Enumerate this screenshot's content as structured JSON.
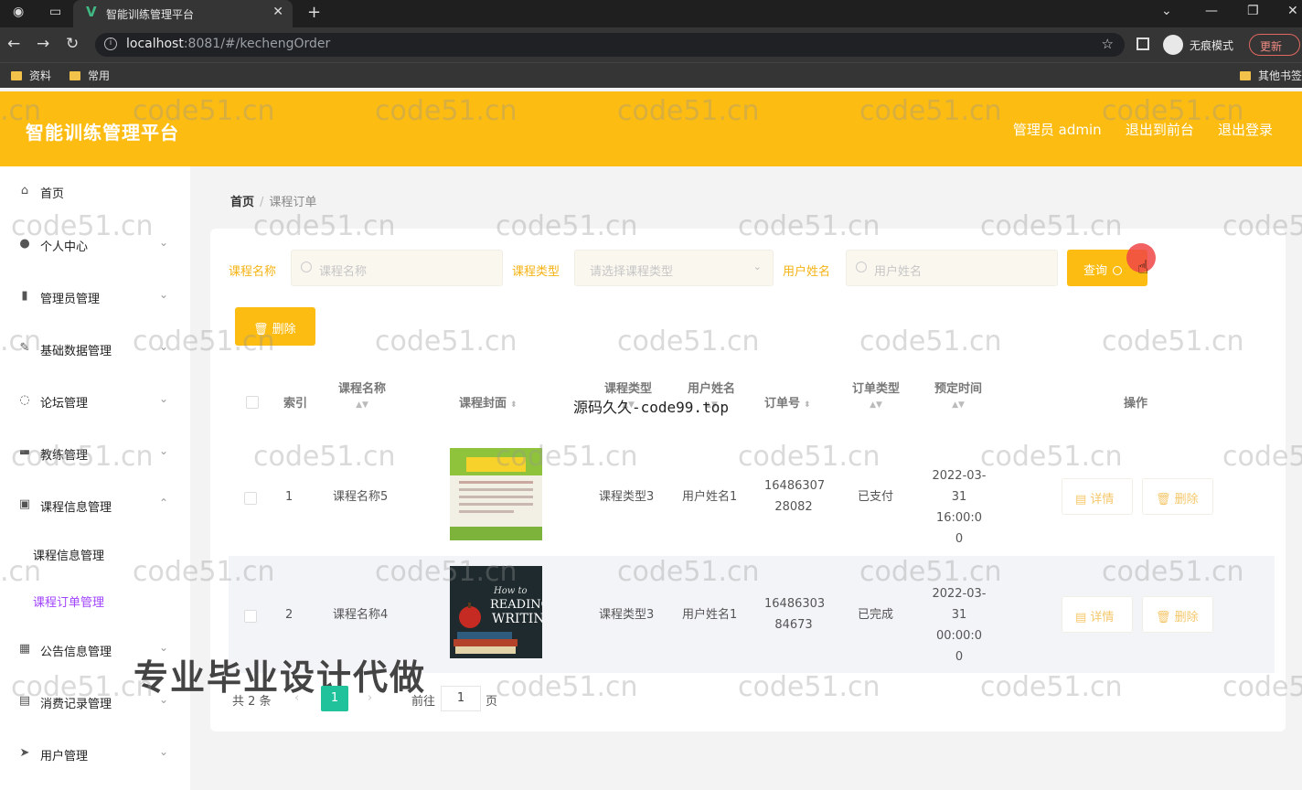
{
  "browser": {
    "tab_title": "智能训练管理平台",
    "url_host": "localhost",
    "url_rest": ":8081/#/kechengOrder",
    "incognito_label": "无痕模式",
    "update_label": "更新",
    "bookmarks": [
      "资料",
      "常用",
      "其他书签"
    ]
  },
  "header": {
    "title": "智能训练管理平台",
    "links": [
      "管理员 admin",
      "退出到前台",
      "退出登录"
    ]
  },
  "sidebar": {
    "items": [
      {
        "label": "首页",
        "icon": "home-icon"
      },
      {
        "label": "个人中心",
        "icon": "user-icon"
      },
      {
        "label": "管理员管理",
        "icon": "admin-icon"
      },
      {
        "label": "基础数据管理",
        "icon": "edit-icon"
      },
      {
        "label": "论坛管理",
        "icon": "power-icon"
      },
      {
        "label": "教练管理",
        "icon": "chat-icon"
      },
      {
        "label": "课程信息管理",
        "icon": "course-icon"
      },
      {
        "label": "公告信息管理",
        "icon": "grid-icon"
      },
      {
        "label": "消费记录管理",
        "icon": "record-icon"
      },
      {
        "label": "用户管理",
        "icon": "send-icon"
      }
    ],
    "sub_items": [
      "课程信息管理",
      "课程订单管理"
    ]
  },
  "breadcrumb": {
    "home": "首页",
    "current": "课程订单"
  },
  "filters": {
    "course_name_label": "课程名称",
    "course_name_placeholder": "课程名称",
    "course_type_label": "课程类型",
    "course_type_placeholder": "请选择课程类型",
    "user_name_label": "用户姓名",
    "user_name_placeholder": "用户姓名",
    "query_label": "查询"
  },
  "toolbar": {
    "delete_label": "删除"
  },
  "table": {
    "headers": [
      "索引",
      "课程名称",
      "课程封面",
      "课程类型",
      "用户姓名",
      "订单号",
      "订单类型",
      "预定时间",
      "操作"
    ],
    "rows": [
      {
        "index": "1",
        "name": "课程名称5",
        "type": "课程类型3",
        "user": "用户姓名1",
        "order_no_a": "16486307",
        "order_no_b": "28082",
        "status": "已支付",
        "time_a": "2022-03-",
        "time_b": "31 16:00:0",
        "time_c": "0",
        "detail": "详情",
        "delete": "删除"
      },
      {
        "index": "2",
        "name": "课程名称4",
        "type": "课程类型3",
        "user": "用户姓名1",
        "order_no_a": "16486303",
        "order_no_b": "84673",
        "status": "已完成",
        "time_a": "2022-03-",
        "time_b": "31 00:00:0",
        "time_c": "0",
        "detail": "详情",
        "delete": "删除"
      }
    ]
  },
  "pagination": {
    "total": "共 2 条",
    "current": "1",
    "goto_prefix": "前往",
    "goto_value": "1",
    "goto_suffix": "页"
  },
  "overlays": {
    "source_watermark": "源码久久-code99.top",
    "ad_banner": "专业毕业设计代做",
    "watermark": "code51.cn",
    "watermark_partial_a": ".cn",
    "watermark_partial_b": "code5"
  },
  "colors": {
    "accent": "#fcbc12",
    "active_menu": "#a144ff",
    "page_active": "#1fc29b"
  }
}
